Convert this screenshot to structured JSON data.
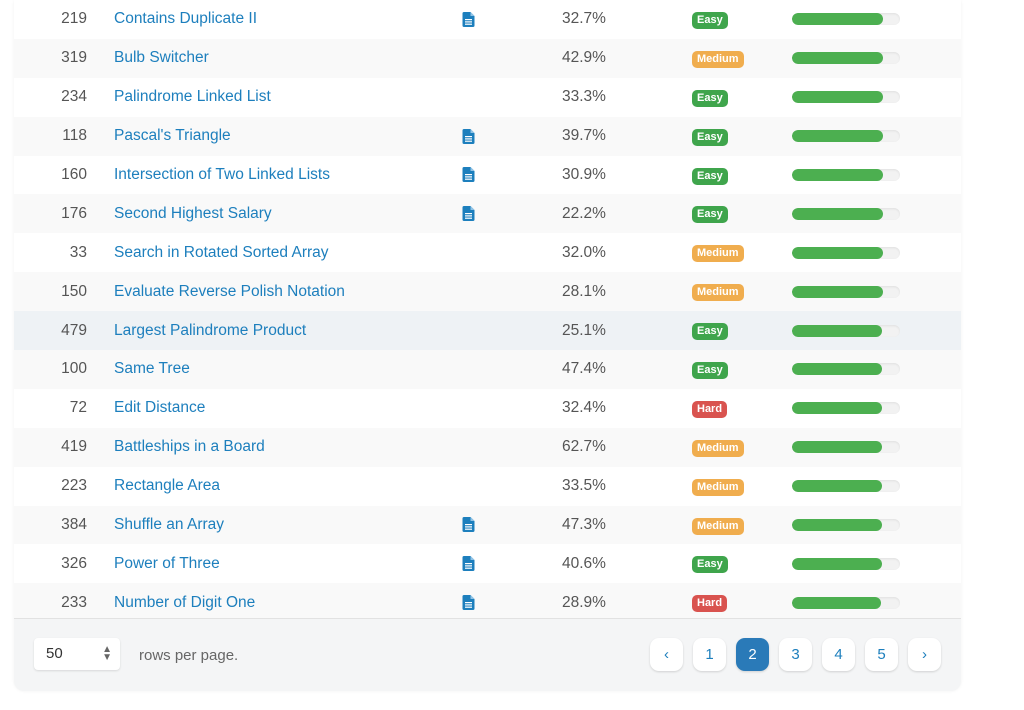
{
  "rows": [
    {
      "id": "219",
      "title": "Contains Duplicate II",
      "solution": true,
      "acceptance": "32.7%",
      "difficulty": "Easy",
      "freq": 0.84
    },
    {
      "id": "319",
      "title": "Bulb Switcher",
      "solution": false,
      "acceptance": "42.9%",
      "difficulty": "Medium",
      "freq": 0.84
    },
    {
      "id": "234",
      "title": "Palindrome Linked List",
      "solution": false,
      "acceptance": "33.3%",
      "difficulty": "Easy",
      "freq": 0.84
    },
    {
      "id": "118",
      "title": "Pascal's Triangle",
      "solution": true,
      "acceptance": "39.7%",
      "difficulty": "Easy",
      "freq": 0.84
    },
    {
      "id": "160",
      "title": "Intersection of Two Linked Lists",
      "solution": true,
      "acceptance": "30.9%",
      "difficulty": "Easy",
      "freq": 0.84
    },
    {
      "id": "176",
      "title": "Second Highest Salary",
      "solution": true,
      "acceptance": "22.2%",
      "difficulty": "Easy",
      "freq": 0.84
    },
    {
      "id": "33",
      "title": "Search in Rotated Sorted Array",
      "solution": false,
      "acceptance": "32.0%",
      "difficulty": "Medium",
      "freq": 0.84
    },
    {
      "id": "150",
      "title": "Evaluate Reverse Polish Notation",
      "solution": false,
      "acceptance": "28.1%",
      "difficulty": "Medium",
      "freq": 0.84
    },
    {
      "id": "479",
      "title": "Largest Palindrome Product",
      "solution": false,
      "acceptance": "25.1%",
      "difficulty": "Easy",
      "freq": 0.83
    },
    {
      "id": "100",
      "title": "Same Tree",
      "solution": false,
      "acceptance": "47.4%",
      "difficulty": "Easy",
      "freq": 0.83
    },
    {
      "id": "72",
      "title": "Edit Distance",
      "solution": false,
      "acceptance": "32.4%",
      "difficulty": "Hard",
      "freq": 0.83
    },
    {
      "id": "419",
      "title": "Battleships in a Board",
      "solution": false,
      "acceptance": "62.7%",
      "difficulty": "Medium",
      "freq": 0.83
    },
    {
      "id": "223",
      "title": "Rectangle Area",
      "solution": false,
      "acceptance": "33.5%",
      "difficulty": "Medium",
      "freq": 0.83
    },
    {
      "id": "384",
      "title": "Shuffle an Array",
      "solution": true,
      "acceptance": "47.3%",
      "difficulty": "Medium",
      "freq": 0.83
    },
    {
      "id": "326",
      "title": "Power of Three",
      "solution": true,
      "acceptance": "40.6%",
      "difficulty": "Easy",
      "freq": 0.83
    },
    {
      "id": "233",
      "title": "Number of Digit One",
      "solution": true,
      "acceptance": "28.9%",
      "difficulty": "Hard",
      "freq": 0.82
    }
  ],
  "difficulty_colors": {
    "Easy": "#3fa54c",
    "Medium": "#f0ad4e",
    "Hard": "#d9534f"
  },
  "colors": {
    "link": "#1d7fbd",
    "freq_bar": "#4caf50",
    "active_page": "#2a7ab8"
  },
  "hover_row_index": 8,
  "footer": {
    "rows_per_page_value": "50",
    "rows_per_page_label": "rows per page.",
    "prev_label": "‹",
    "next_label": "›",
    "pages": [
      "1",
      "2",
      "3",
      "4",
      "5"
    ],
    "active_page": "2"
  }
}
